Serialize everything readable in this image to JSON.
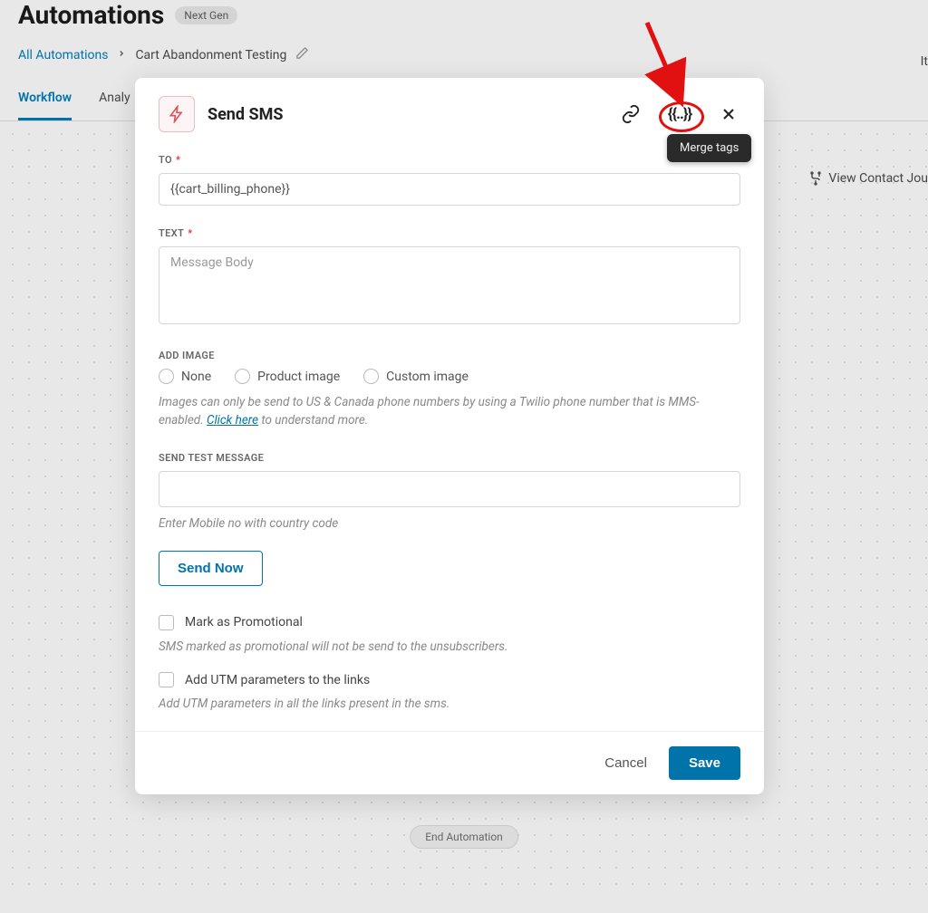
{
  "header": {
    "title": "Automations",
    "badge": "Next Gen"
  },
  "breadcrumb": {
    "link": "All Automations",
    "current": "Cart Abandonment Testing"
  },
  "tabs": [
    "Workflow",
    "Analy"
  ],
  "right_partial": "It",
  "canvas": {
    "view_journey": "View Contact Jou",
    "end_node": "End Automation"
  },
  "modal": {
    "title": "Send SMS",
    "tooltip": "Merge tags",
    "to_label": "TO",
    "to_value": "{{cart_billing_phone}}",
    "text_label": "TEXT",
    "text_placeholder": "Message Body",
    "add_image_label": "ADD IMAGE",
    "image_options": [
      "None",
      "Product image",
      "Custom image"
    ],
    "image_helper_1": "Images can only be send to US & Canada phone numbers by using a Twilio phone number that is MMS-enabled. ",
    "image_helper_link": "Click here",
    "image_helper_2": " to understand more.",
    "send_test_label": "SEND TEST MESSAGE",
    "send_test_helper": "Enter Mobile no with country code",
    "send_now": "Send Now",
    "promo_label": "Mark as Promotional",
    "promo_helper": "SMS marked as promotional will not be send to the unsubscribers.",
    "utm_label": "Add UTM parameters to the links",
    "utm_helper": "Add UTM parameters in all the links present in the sms.",
    "cancel": "Cancel",
    "save": "Save"
  }
}
